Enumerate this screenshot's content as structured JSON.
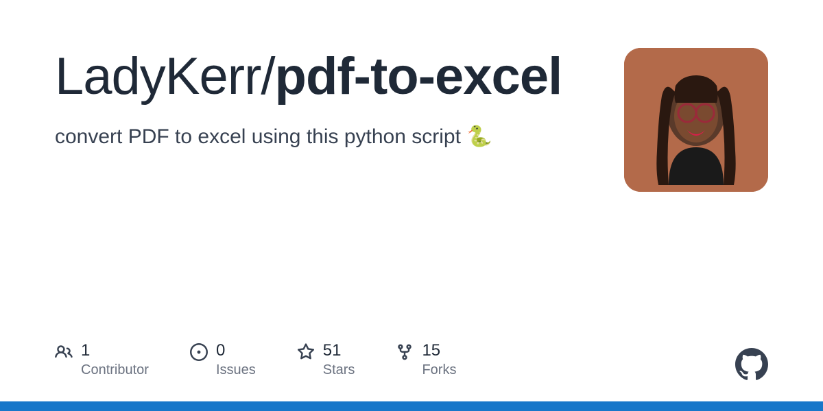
{
  "repo": {
    "owner": "LadyKerr",
    "separator": "/",
    "name": "pdf-to-excel"
  },
  "description": "convert PDF to excel using this python script 🐍",
  "stats": {
    "contributors": {
      "value": "1",
      "label": "Contributor"
    },
    "issues": {
      "value": "0",
      "label": "Issues"
    },
    "stars": {
      "value": "51",
      "label": "Stars"
    },
    "forks": {
      "value": "15",
      "label": "Forks"
    }
  },
  "colors": {
    "accent_bar": "#1877c9",
    "text_primary": "#1f2937",
    "text_secondary": "#6b7280",
    "avatar_bg": "#b36a4a"
  }
}
